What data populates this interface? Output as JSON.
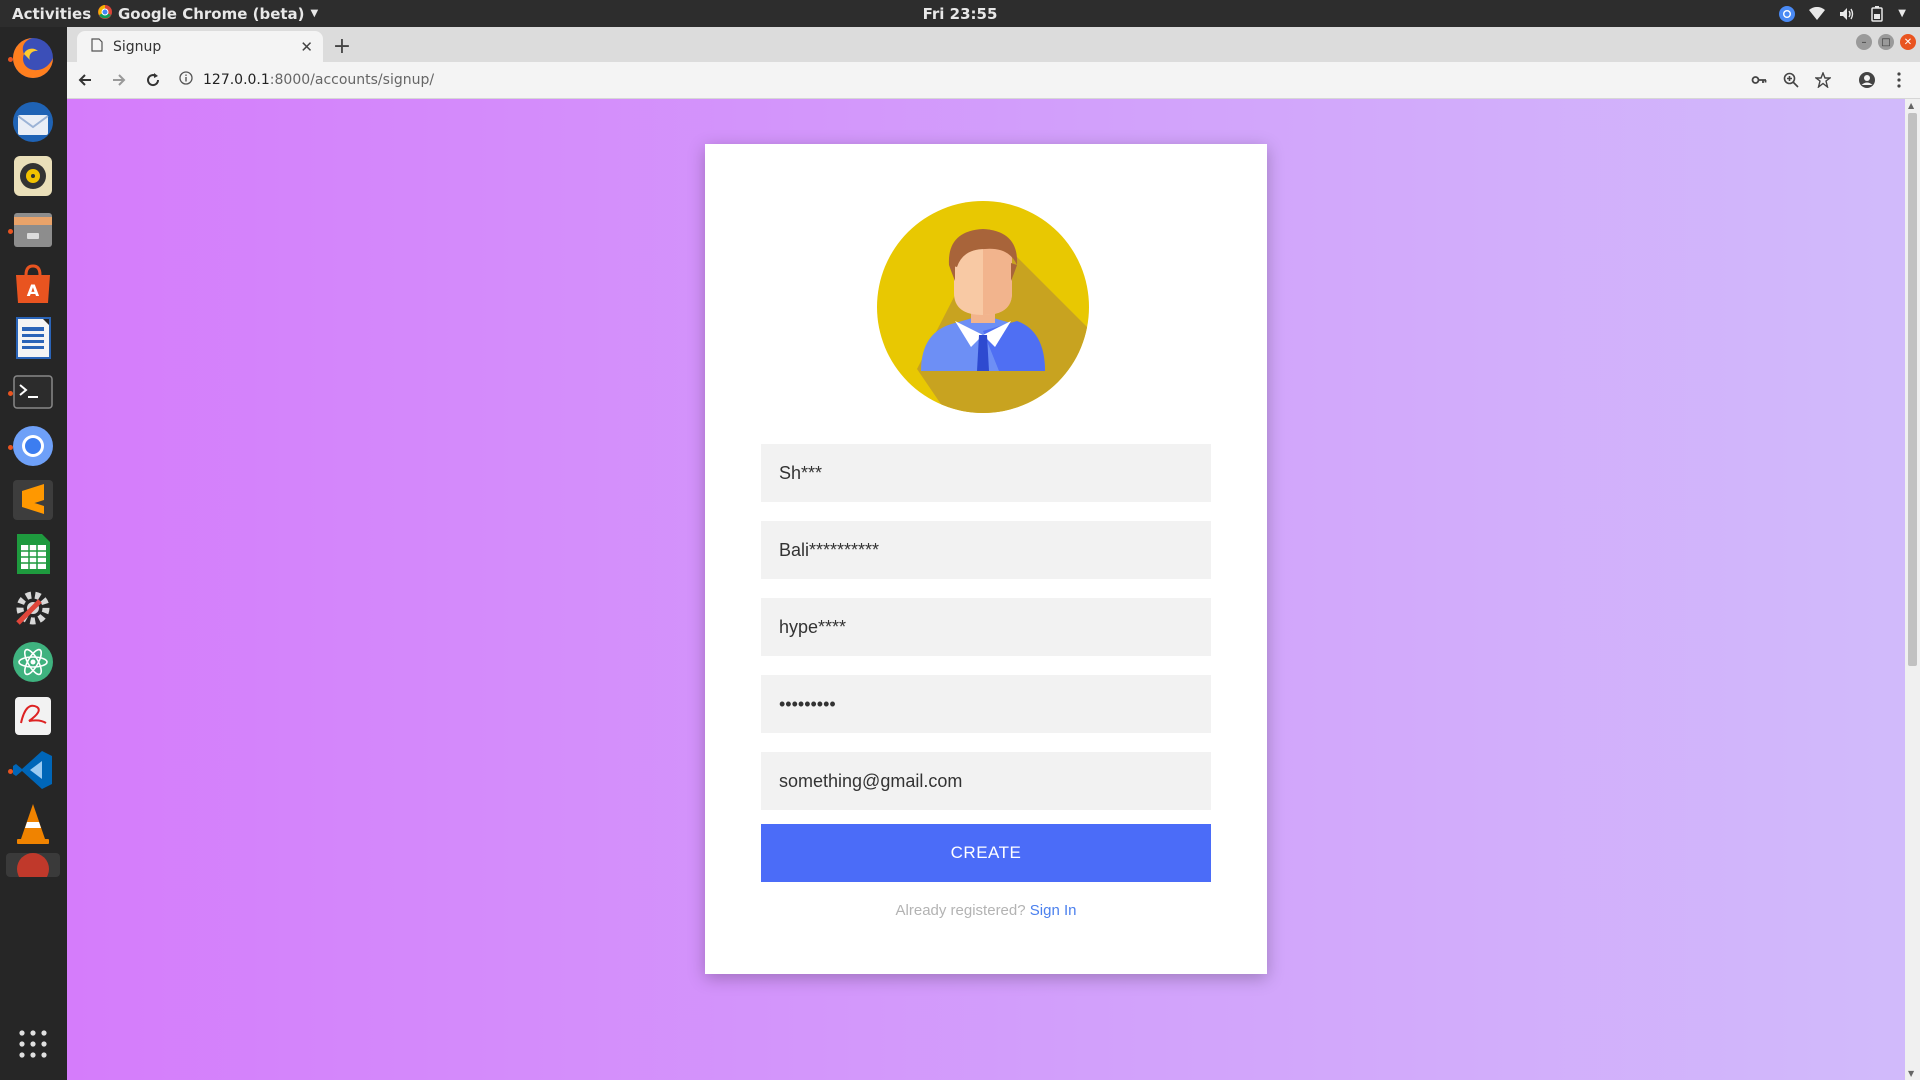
{
  "topbar": {
    "activities": "Activities",
    "app_name": "Google Chrome (beta)",
    "clock": "Fri 23:55"
  },
  "dock": {
    "apps": [
      {
        "name": "firefox",
        "color": "#e66000"
      },
      {
        "name": "thunderbird",
        "color": "#2a6ebb"
      },
      {
        "name": "rhythmbox",
        "color": "#f2c200"
      },
      {
        "name": "files",
        "color": "#e9a36a"
      },
      {
        "name": "ubuntu-software",
        "color": "#e95420"
      },
      {
        "name": "libreoffice-writer",
        "color": "#2a64b8"
      },
      {
        "name": "terminal",
        "color": "#2d2d2d"
      },
      {
        "name": "chromium",
        "color": "#4285f4"
      },
      {
        "name": "sublime-text",
        "color": "#ff9800"
      },
      {
        "name": "libreoffice-calc",
        "color": "#1e9a3e"
      },
      {
        "name": "system-tools",
        "color": "#8a8a8a"
      },
      {
        "name": "atom",
        "color": "#3fb27f"
      },
      {
        "name": "evince",
        "color": "#f0f0f0"
      },
      {
        "name": "vscode",
        "color": "#0066b8"
      },
      {
        "name": "vlc",
        "color": "#f08300"
      },
      {
        "name": "show-applications",
        "color": "#dddddd"
      }
    ]
  },
  "browser": {
    "tab_title": "Signup",
    "url_host": "127.0.0.1",
    "url_path": ":8000/accounts/signup/"
  },
  "form": {
    "fields": [
      {
        "name": "first-name-field",
        "value": "Sh***"
      },
      {
        "name": "last-name-field",
        "value": "Bali**********"
      },
      {
        "name": "username-field",
        "value": "hype****"
      },
      {
        "name": "password-field",
        "value": "•••••••••"
      },
      {
        "name": "email-field",
        "value": "something@gmail.com"
      }
    ],
    "create_label": "CREATE",
    "already_registered": "Already registered?",
    "sign_in_label": "Sign In"
  },
  "colors": {
    "gradient_left": "#d57cfb",
    "gradient_right": "#d1bbfb",
    "button": "#4b6cf8",
    "link": "#4b80ee",
    "avatar_circle": "#e8c802"
  }
}
